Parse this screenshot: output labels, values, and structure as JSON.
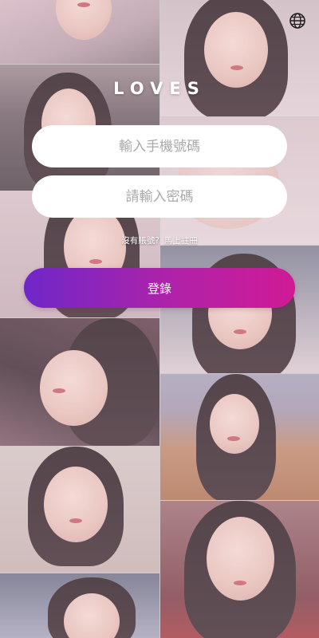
{
  "app": {
    "title": "LOVES"
  },
  "icons": {
    "language": "globe-icon"
  },
  "login_form": {
    "phone_placeholder": "輸入手機號碼",
    "password_placeholder": "請輸入密碼",
    "no_account_text": "沒有賬號?",
    "register_link": "馬上註冊",
    "login_button": "登錄"
  },
  "colors": {
    "button_gradient_start": "#6f27c9",
    "button_gradient_end": "#d11a96",
    "input_background": "#ffffff",
    "title_color": "#ffffff"
  }
}
